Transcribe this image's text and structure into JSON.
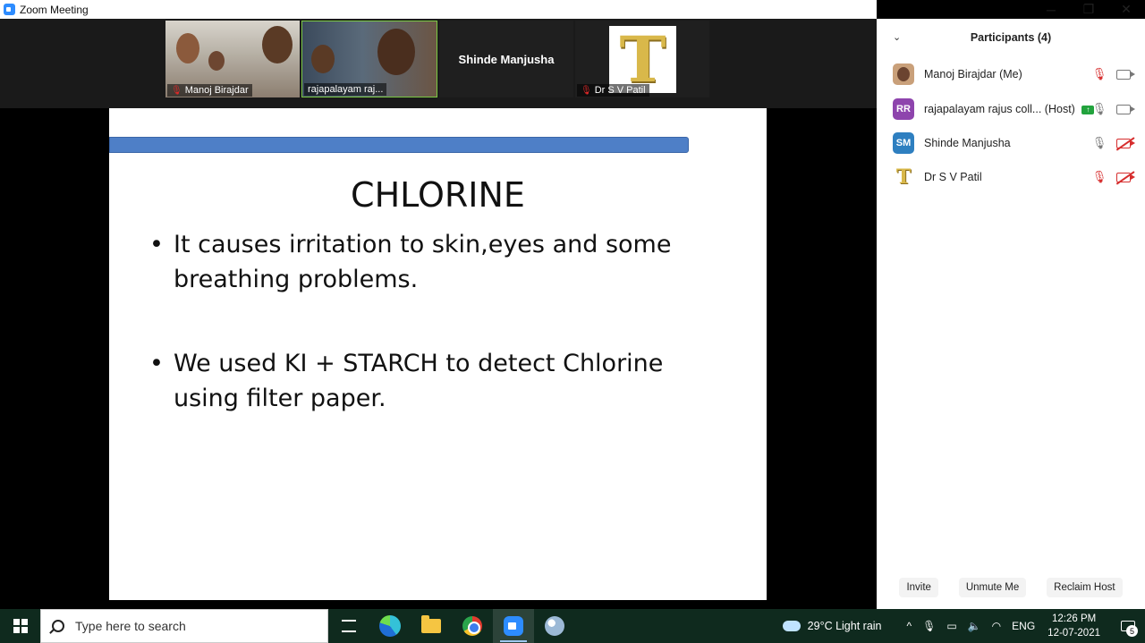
{
  "window": {
    "title": "Zoom Meeting",
    "controls": {
      "minimize": "─",
      "restore": "❐",
      "close": "✕"
    }
  },
  "video_strip": {
    "tiles": [
      {
        "name": "Manoj Birajdar",
        "muted": true
      },
      {
        "name": "rajapalayam raj...",
        "muted": false,
        "speaking": true
      },
      {
        "name": "Shinde Manjusha",
        "muted": false
      },
      {
        "name": "Dr S V Patil",
        "muted": true,
        "photo_letter": "T"
      }
    ]
  },
  "slide": {
    "heading": "CHLORINE",
    "bullets": [
      "It causes irritation to skin,eyes and some breathing problems.",
      "We used KI + STARCH to detect Chlorine using filter paper."
    ],
    "bullet_glyph": "•"
  },
  "participants": {
    "title": "Participants (4)",
    "collapse_glyph": "⌄",
    "list": [
      {
        "name": "Manoj Birajdar (Me)",
        "avatar": "photo",
        "mic": "muted",
        "video": "on"
      },
      {
        "name": "rajapalayam rajus coll...",
        "role": "(Host)",
        "avatar_initials": "RR",
        "avatar_color": "#8e44ad",
        "mic": "on",
        "video": "on",
        "sharing": true,
        "share_glyph": "↑"
      },
      {
        "name": "Shinde Manjusha",
        "avatar_initials": "SM",
        "avatar_color": "#2e7fc0",
        "mic": "on",
        "video": "off"
      },
      {
        "name": "Dr S V Patil",
        "avatar": "T",
        "mic": "muted",
        "video": "off"
      }
    ],
    "buttons": {
      "invite": "Invite",
      "unmute": "Unmute Me",
      "reclaim": "Reclaim Host"
    }
  },
  "taskbar": {
    "search_placeholder": "Type here to search",
    "apps": [
      "task-view",
      "edge",
      "file-explorer",
      "chrome",
      "zoom",
      "paint"
    ],
    "weather": "29°C  Light rain",
    "tray_chevron": "^",
    "language": "ENG",
    "time": "12:26 PM",
    "date": "12-07-2021",
    "notification_count": "5"
  }
}
